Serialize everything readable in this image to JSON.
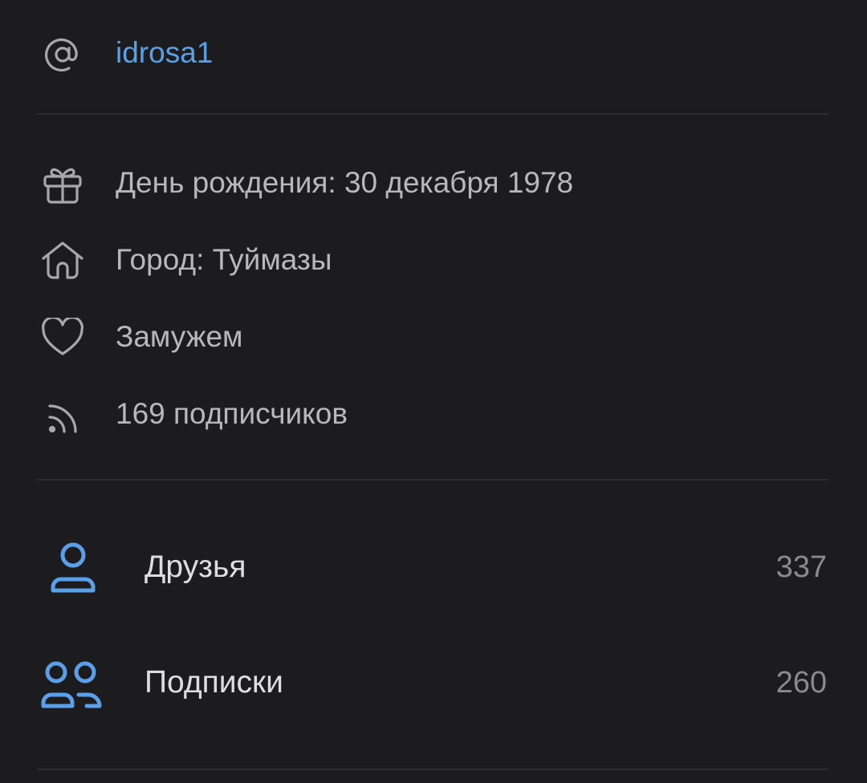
{
  "profile_info": {
    "username": "idrosa1",
    "birthday": "День рождения: 30 декабря 1978",
    "city": "Город: Туймазы",
    "relationship": "Замужем",
    "followers": "169 подписчиков"
  },
  "links": [
    {
      "label": "Друзья",
      "count": "337",
      "icon": "person-icon"
    },
    {
      "label": "Подписки",
      "count": "260",
      "icon": "group-icon"
    }
  ],
  "colors": {
    "background": "#1c1c1e",
    "accent": "#5b9fe9",
    "text": "#b8b8bc",
    "icon": "#a8a8ac",
    "divider": "#2d2d30"
  }
}
